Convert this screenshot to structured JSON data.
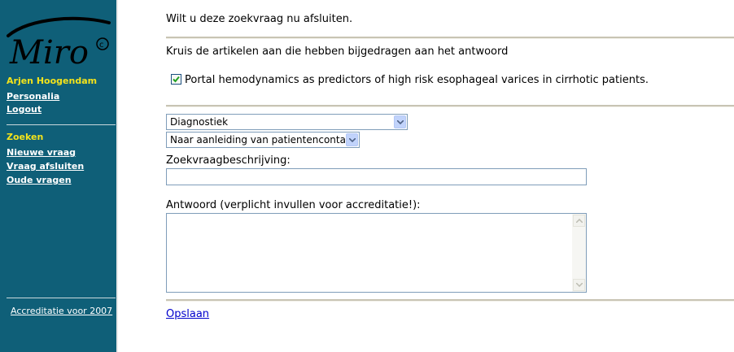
{
  "sidebar": {
    "logo_text": "Miro",
    "logo_symbol": "©",
    "user_name": "Arjen Hoogendam",
    "links": [
      "Personalia",
      "Logout"
    ],
    "section_title": "Zoeken",
    "search_links": [
      "Nieuwe vraag",
      "Vraag afsluiten",
      "Oude vragen"
    ],
    "accreditation_link": "Accreditatie voor 2007"
  },
  "main": {
    "prompt": "Wilt u deze zoekvraag nu afsluiten.",
    "articles_instruction": "Kruis de artikelen aan die hebben bijgedragen aan het antwoord",
    "articles": [
      {
        "title": "Portal hemodynamics as predictors of high risk esophageal varices in cirrhotic patients.",
        "checked": true
      }
    ],
    "category_select": "Diagnostiek",
    "reason_select": "Naar aanleiding van patientencontact",
    "description_label": "Zoekvraagbeschrijving:",
    "description_value": "",
    "answer_label": "Antwoord (verplicht invullen voor accreditatie!):",
    "answer_value": "",
    "save_link": "Opslaan"
  }
}
